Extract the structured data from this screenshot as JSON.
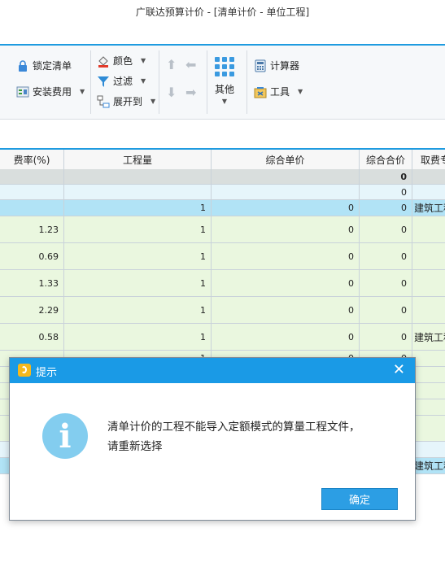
{
  "window": {
    "title": "广联达预算计价 - [清单计价 - 单位工程]"
  },
  "ribbon": {
    "lock_list": "锁定清单",
    "install_fee": "安装费用",
    "color": "颜色",
    "filter": "过滤",
    "expand_to": "展开到",
    "other": "其他",
    "calculator": "计算器",
    "tools": "工具"
  },
  "table": {
    "headers": [
      "费率(%)",
      "工程量",
      "综合单价",
      "综合合价",
      "取费专业"
    ],
    "rows": [
      {
        "rate": "",
        "qty": "",
        "unit_price": "",
        "total": "0",
        "fee": ""
      },
      {
        "rate": "",
        "qty": "",
        "unit_price": "",
        "total": "0",
        "fee": ""
      },
      {
        "rate": "",
        "qty": "1",
        "unit_price": "0",
        "total": "0",
        "fee": "建筑工程"
      },
      {
        "rate": "1.23",
        "qty": "1",
        "unit_price": "0",
        "total": "0",
        "fee": ""
      },
      {
        "rate": "0.69",
        "qty": "1",
        "unit_price": "0",
        "total": "0",
        "fee": ""
      },
      {
        "rate": "1.33",
        "qty": "1",
        "unit_price": "0",
        "total": "0",
        "fee": ""
      },
      {
        "rate": "2.29",
        "qty": "1",
        "unit_price": "0",
        "total": "0",
        "fee": ""
      },
      {
        "rate": "0.58",
        "qty": "1",
        "unit_price": "0",
        "total": "0",
        "fee": "建筑工程"
      },
      {
        "rate": "",
        "qty": "1",
        "unit_price": "0",
        "total": "0",
        "fee": ""
      },
      {
        "rate": "",
        "qty": "",
        "unit_price": "",
        "total": "",
        "fee": ""
      },
      {
        "rate": "",
        "qty": "",
        "unit_price": "",
        "total": "",
        "fee": ""
      },
      {
        "rate": "",
        "qty": "",
        "unit_price": "",
        "total": "",
        "fee": ""
      },
      {
        "rate": "",
        "qty": "",
        "unit_price": "",
        "total": "",
        "fee": ""
      },
      {
        "rate": "",
        "qty": "",
        "unit_price": "",
        "total": "",
        "fee": ""
      },
      {
        "rate": "",
        "qty": "",
        "unit_price": "",
        "total": "",
        "fee": "建筑工程"
      }
    ]
  },
  "dialog": {
    "title": "提示",
    "message_line1": "清单计价的工程不能导入定额模式的算量工程文件，",
    "message_line2": "请重新选择",
    "ok": "确定"
  },
  "colors": {
    "accent": "#1a9ae6",
    "row_grey": "#d9dedd",
    "row_lightblue": "#e6f5fb",
    "row_blue": "#b1e3f6",
    "row_green": "#eaf7df"
  }
}
